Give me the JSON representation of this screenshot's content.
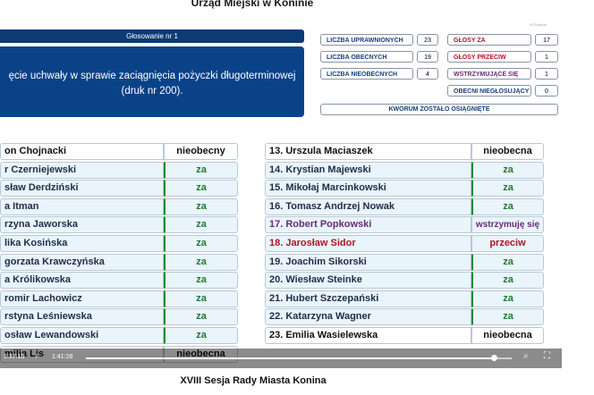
{
  "header": {
    "title": "Urząd Miejski w Koninie",
    "corner_mark": "HCSystem"
  },
  "voting": {
    "label": "Głosowanie nr 1",
    "motion_line1": "ęcie uchwały w sprawie zaciągnięcia pożyczki długoterminowej",
    "motion_line2": "(druk nr 200)."
  },
  "stats": {
    "uprawnionych": {
      "label": "LICZBA UPRAWNIONYCH",
      "value": "23"
    },
    "obecnych": {
      "label": "LICZBA OBECNYCH",
      "value": "19"
    },
    "nieobecnych": {
      "label": "LICZBA NIEOBECNYCH",
      "value": "4"
    },
    "za": {
      "label": "GŁOSY ZA",
      "value": "17"
    },
    "przeciw": {
      "label": "GŁOSY PRZECIW",
      "value": "1"
    },
    "wstrzymujace": {
      "label": "WSTRZYMUJĄCE SIĘ",
      "value": "1"
    },
    "nieglosujacy": {
      "label": "OBECNI NIEGŁOSUJĄCY",
      "value": "0"
    },
    "kworum": "KWORUM ZOSTAŁO OSIĄGNIĘTE"
  },
  "left_rows": [
    {
      "name": "on Chojnacki",
      "vote": "nieobecny",
      "status": "absent"
    },
    {
      "name": "r Czerniejewski",
      "vote": "za",
      "status": "for"
    },
    {
      "name": "sław Derdziński",
      "vote": "za",
      "status": "for"
    },
    {
      "name": "a Itman",
      "vote": "za",
      "status": "for"
    },
    {
      "name": "rzyna Jaworska",
      "vote": "za",
      "status": "for"
    },
    {
      "name": "lika Kosińska",
      "vote": "za",
      "status": "for"
    },
    {
      "name": "gorzata Krawczyńska",
      "vote": "za",
      "status": "for"
    },
    {
      "name": "a Królikowska",
      "vote": "za",
      "status": "for"
    },
    {
      "name": "romir Lachowicz",
      "vote": "za",
      "status": "for"
    },
    {
      "name": "rstyna Leśniewska",
      "vote": "za",
      "status": "for"
    },
    {
      "name": "osław Lewandowski",
      "vote": "za",
      "status": "for"
    },
    {
      "name": "milia Lis",
      "vote": "nieobecna",
      "status": "absent"
    }
  ],
  "right_rows": [
    {
      "name": "13. Urszula Maciaszek",
      "vote": "nieobecna",
      "status": "absent"
    },
    {
      "name": "14. Krystian Majewski",
      "vote": "za",
      "status": "for"
    },
    {
      "name": "15. Mikołaj Marcinkowski",
      "vote": "za",
      "status": "for"
    },
    {
      "name": "16. Tomasz Andrzej Nowak",
      "vote": "za",
      "status": "for"
    },
    {
      "name": "17. Robert Popkowski",
      "vote": "wstrzymuję się",
      "status": "abst"
    },
    {
      "name": "18. Jarosław Sidor",
      "vote": "przeciw",
      "status": "against"
    },
    {
      "name": "19. Joachim Sikorski",
      "vote": "za",
      "status": "for"
    },
    {
      "name": "20. Wiesław Steinke",
      "vote": "za",
      "status": "for"
    },
    {
      "name": "21. Hubert Szczepański",
      "vote": "za",
      "status": "for"
    },
    {
      "name": "22. Katarzyna Wagner",
      "vote": "za",
      "status": "for"
    },
    {
      "name": "23. Emilia Wasielewska",
      "vote": "nieobecna",
      "status": "absent"
    }
  ],
  "player": {
    "current_time": "1:37:15",
    "separator": "/",
    "duration": "1:41:28",
    "progress": 0.958,
    "icons": [
      "fullscreen-icon"
    ]
  },
  "footer": {
    "title": "XVIII Sesja Rady Miasta Konina"
  }
}
